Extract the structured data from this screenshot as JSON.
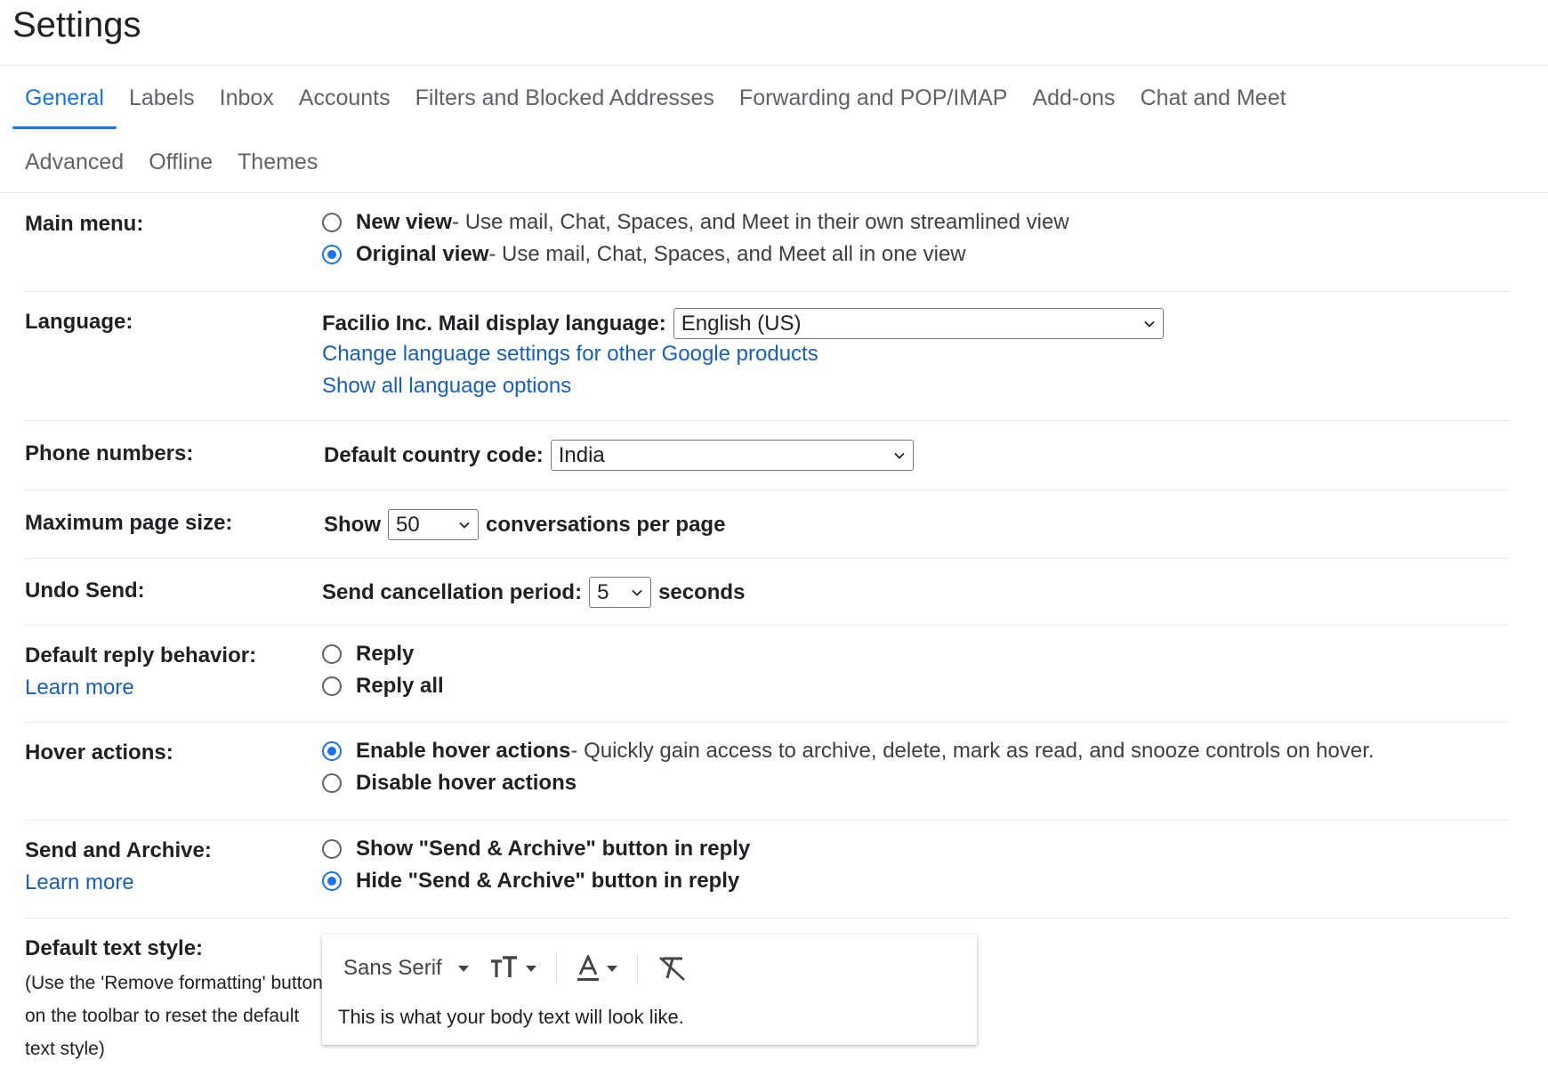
{
  "page": {
    "title": "Settings"
  },
  "tabs": {
    "row1": [
      "General",
      "Labels",
      "Inbox",
      "Accounts",
      "Filters and Blocked Addresses",
      "Forwarding and POP/IMAP",
      "Add-ons",
      "Chat and Meet"
    ],
    "row2": [
      "Advanced",
      "Offline",
      "Themes"
    ],
    "active": "General"
  },
  "main_menu": {
    "label": "Main menu:",
    "options": [
      {
        "title": "New view",
        "desc": " - Use mail, Chat, Spaces, and Meet in their own streamlined view",
        "selected": false
      },
      {
        "title": "Original view",
        "desc": " - Use mail, Chat, Spaces, and Meet all in one view",
        "selected": true
      }
    ]
  },
  "language": {
    "label": "Language:",
    "display_label": "Facilio Inc. Mail display language:",
    "selected": "English (US)",
    "link1": "Change language settings for other Google products",
    "link2": "Show all language options"
  },
  "phone": {
    "label": "Phone numbers:",
    "field_label": "Default country code:",
    "selected": "India"
  },
  "page_size": {
    "label": "Maximum page size:",
    "prefix": "Show",
    "selected": "50",
    "suffix": "conversations per page"
  },
  "undo_send": {
    "label": "Undo Send:",
    "field_label": "Send cancellation period:",
    "selected": "5",
    "suffix": "seconds"
  },
  "reply": {
    "label": "Default reply behavior:",
    "learn": "Learn more",
    "options": [
      {
        "title": "Reply",
        "selected": false
      },
      {
        "title": "Reply all",
        "selected": false
      }
    ]
  },
  "hover": {
    "label": "Hover actions:",
    "options": [
      {
        "title": "Enable hover actions",
        "desc": " - Quickly gain access to archive, delete, mark as read, and snooze controls on hover.",
        "selected": true
      },
      {
        "title": "Disable hover actions",
        "desc": "",
        "selected": false
      }
    ]
  },
  "send_archive": {
    "label": "Send and Archive:",
    "learn": "Learn more",
    "options": [
      {
        "title": "Show \"Send & Archive\" button in reply",
        "selected": false
      },
      {
        "title": "Hide \"Send & Archive\" button in reply",
        "selected": true
      }
    ]
  },
  "text_style": {
    "label": "Default text style:",
    "note": "(Use the 'Remove formatting' button on the toolbar to reset the default text style)",
    "font": "Sans Serif",
    "sample": "This is what your body text will look like."
  },
  "colors": {
    "accent": "#1a73e8",
    "link": "#1a5fb4",
    "divider": "#e8eaed"
  },
  "icons": [
    "chevron-down-icon",
    "caret-down-icon",
    "text-size-icon",
    "text-color-icon",
    "remove-formatting-icon"
  ]
}
